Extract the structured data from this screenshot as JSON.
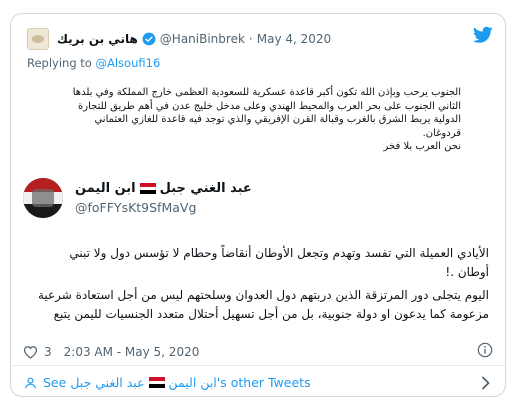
{
  "quoted_tweet": {
    "author_name": "هاني بن بريك",
    "handle": "@HaniBinbrek",
    "separator": "·",
    "date": "May 4, 2020",
    "replying_prefix": "Replying to ",
    "replying_to": "@Alsoufi16",
    "text_lines": [
      "الجنوب يرحب وبإذن الله تكون أكبر قاعدة عسكرية للسعودية العظمى خارج المملكة وفي بلدها",
      "الثاني الجنوب على بحر العرب والمحيط الهندي وعلى مدخل خليج عدن في أهم طريق للتجارة",
      "الدولية يربط الشرق بالغرب وقبالة القرن الإفريقي والذي توجد فيه قاعدة للغازي العثماني",
      "قردوغان.",
      "نحن العرب بلا فخر"
    ]
  },
  "tweet": {
    "name_part1": "ابن اليمن",
    "name_part2": "عبد الغني جبل",
    "handle": "@foFFYsKt9SfMaVg",
    "text_lines": [
      "الأيادي العميلة التي تفسد وتهدم وتجعل الأوطان أنقاضاً وحطام لا تؤسس دول ولا تبني",
      "أوطان .!",
      "",
      "اليوم يتجلى دور المرتزقة الذين دربتهم دول العدوان وسلحتهم ليس من أجل استعادة شرعية",
      "مزعومة كما يدعون او دولة جنوبية، بل من أجل تسهيل أحتلال متعدد الجنسيات لليمن  يتبع"
    ],
    "likes": "3",
    "timestamp": "2:03 AM - May 5, 2020"
  },
  "footer": {
    "see_label": "See",
    "name_part1": "ابن اليمن",
    "name_part2": "عبد الغني جبل",
    "suffix": "'s other Tweets"
  },
  "colors": {
    "link": "#1d9bf0",
    "secondary_text": "#536471",
    "flag_red": "#ce1126",
    "flag_white": "#ffffff",
    "flag_black": "#000000"
  },
  "icons": [
    "twitter-bird-icon",
    "verified-badge-icon",
    "yemen-flag-icon",
    "heart-icon",
    "info-icon",
    "person-icon",
    "chevron-right-icon"
  ]
}
